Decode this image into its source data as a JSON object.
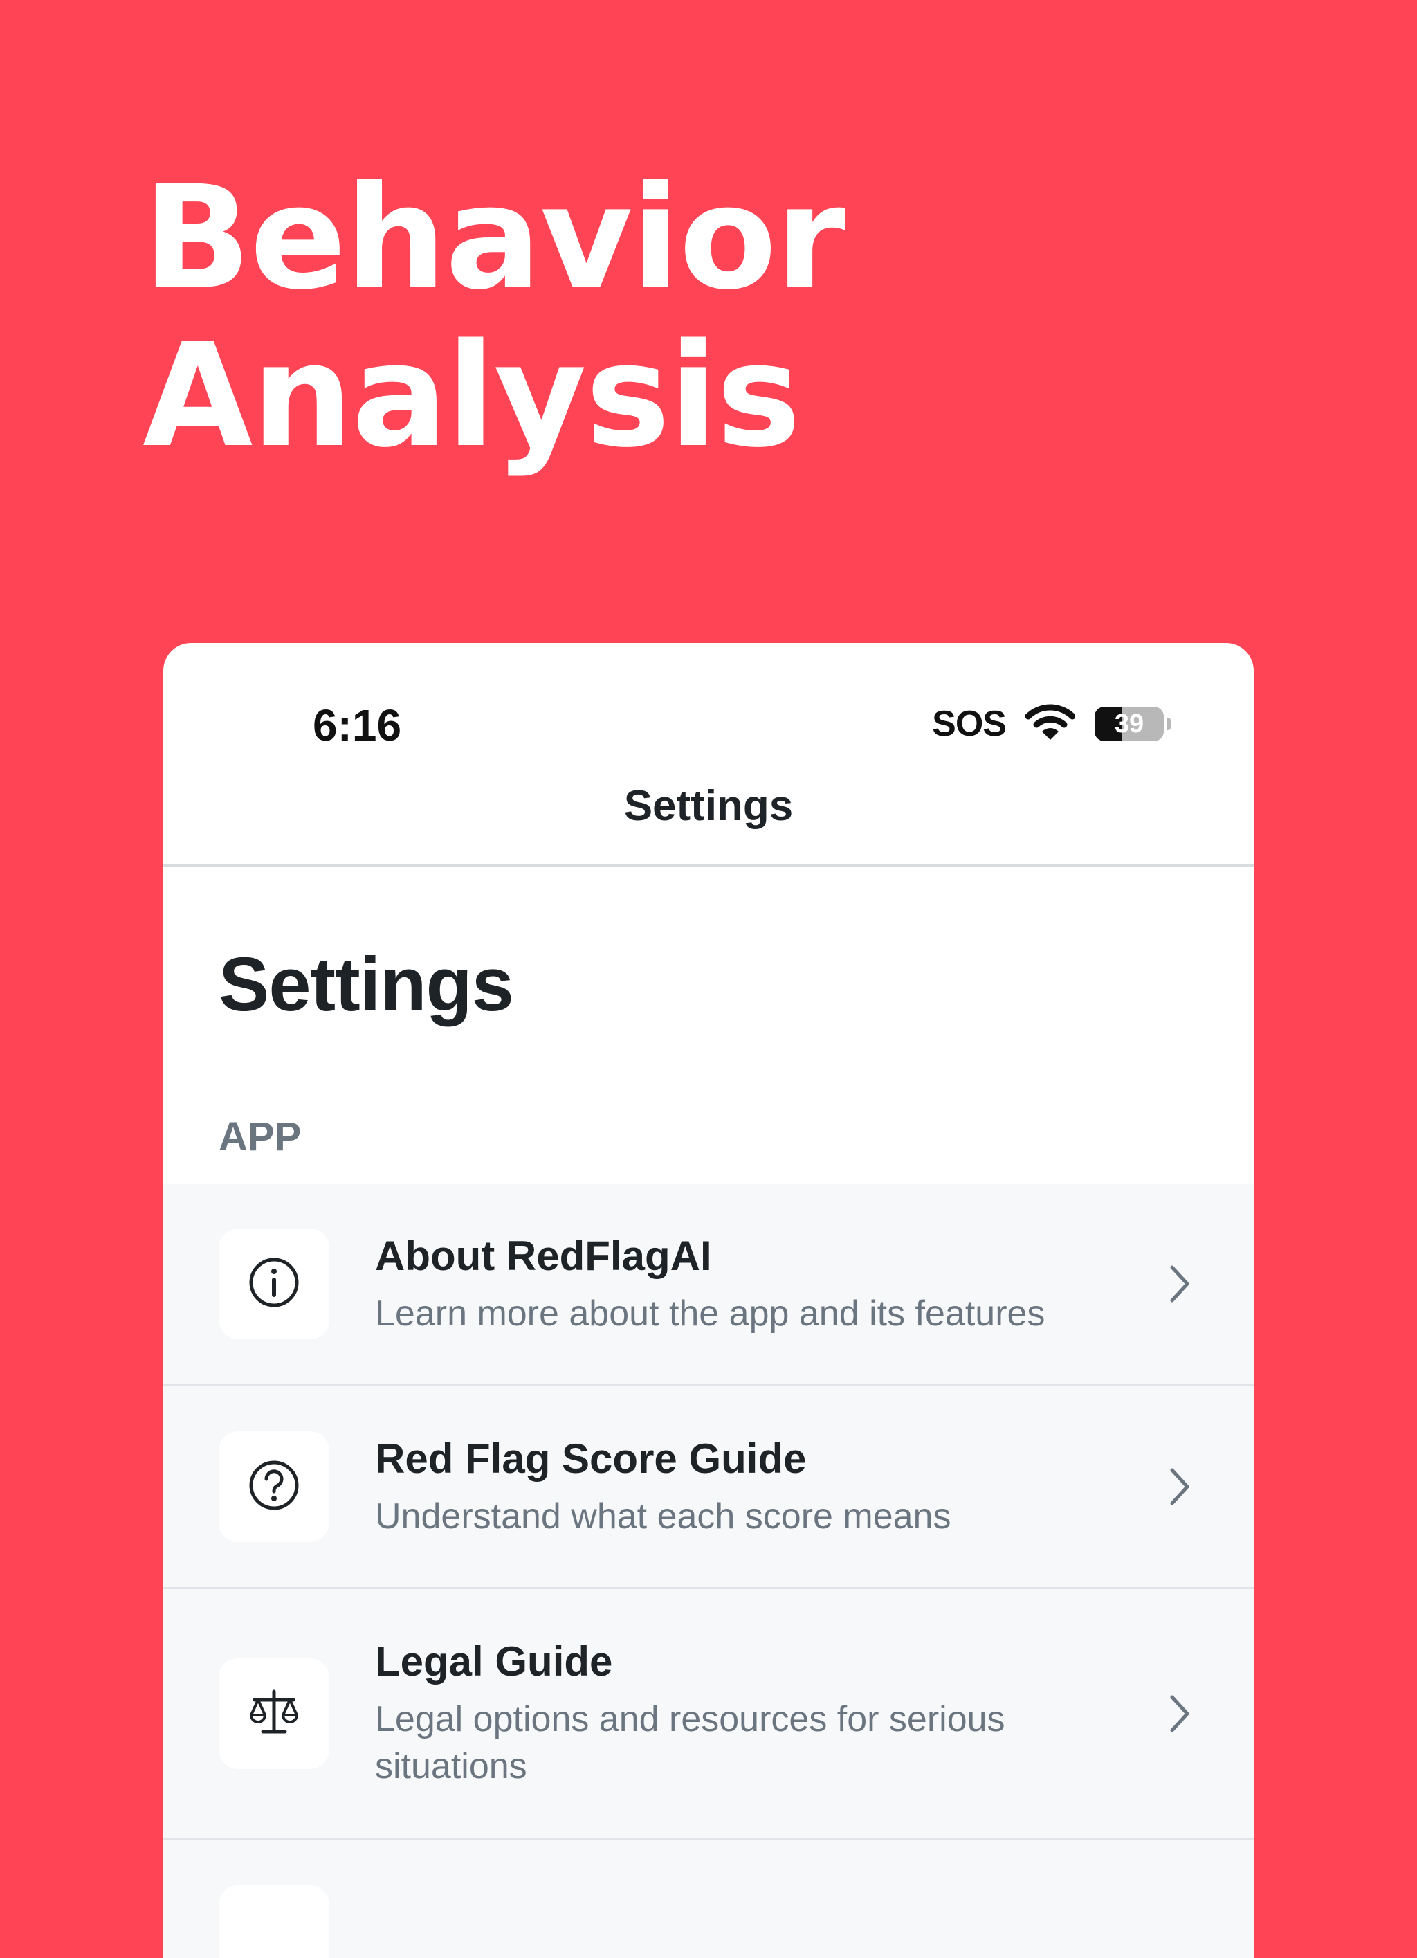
{
  "headline": {
    "line1": "Behavior",
    "line2": "Analysis"
  },
  "status_bar": {
    "time": "6:16",
    "sos": "SOS",
    "battery": "39",
    "battery_level": 0.39
  },
  "nav": {
    "title": "Settings"
  },
  "page": {
    "large_title": "Settings",
    "section_header": "APP"
  },
  "settings_items": [
    {
      "icon": "info-icon",
      "title": "About RedFlagAI",
      "subtitle": "Learn more about the app and its features"
    },
    {
      "icon": "question-icon",
      "title": "Red Flag Score Guide",
      "subtitle": "Understand what each score means"
    },
    {
      "icon": "scale-icon",
      "title": "Legal Guide",
      "subtitle": "Legal options and resources for serious situations"
    }
  ],
  "colors": {
    "background": "#FF4455",
    "card": "#FFFFFF",
    "row_bg": "#F6F8FA",
    "text_primary": "#1E2328",
    "text_secondary": "#6B7580"
  }
}
